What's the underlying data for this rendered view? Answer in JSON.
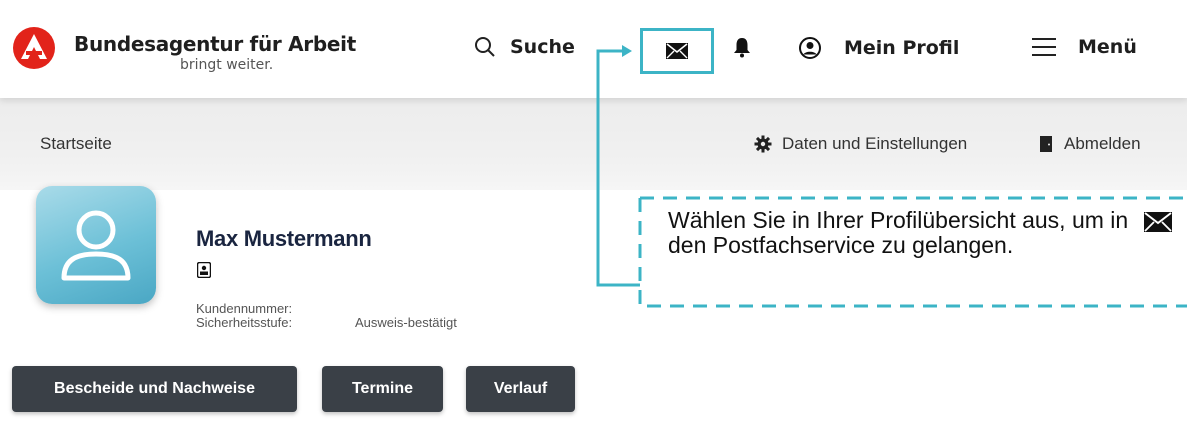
{
  "header": {
    "brand_name": "Bundesagentur für Arbeit",
    "brand_tagline": "bringt weiter.",
    "logo_icon": "ba-logo-icon",
    "search_label": "Suche",
    "mail_icon": "envelope-icon",
    "bell_icon": "bell-icon",
    "profile_label": "Mein Profil",
    "menu_label": "Menü"
  },
  "subbar": {
    "breadcrumb": "Startseite",
    "settings_label": "Daten und Einstellungen",
    "logout_label": "Abmelden"
  },
  "profile": {
    "name": "Max Mustermann",
    "customer_number_label": "Kundennummer:",
    "security_level_label": "Sicherheitsstufe:",
    "security_level_value": "Ausweis-bestätigt"
  },
  "buttons": {
    "documents": "Bescheide und Nachweise",
    "appointments": "Termine",
    "history": "Verlauf"
  },
  "callout": {
    "text": "Wählen Sie in Ihrer Profilübersicht aus, um in den Postfachservice zu gelangen.",
    "icon": "envelope-icon"
  },
  "colors": {
    "accent": "#3cb4c6",
    "logo_red": "#e2231a",
    "button_bg": "#3a4047",
    "name_color": "#1a2540"
  }
}
